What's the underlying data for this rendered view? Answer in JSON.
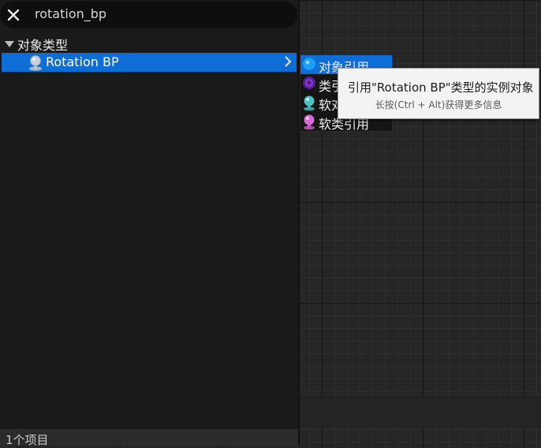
{
  "search": {
    "value": "rotation_bp",
    "clear_icon": "close-icon"
  },
  "tree": {
    "category_label": "对象类型",
    "selected_item": {
      "label": "Rotation BP",
      "icon": "blueprint-class-icon"
    }
  },
  "submenu": {
    "items": [
      {
        "label": "对象引用",
        "icon": "object-reference-icon",
        "color": "#1aa1f5"
      },
      {
        "label": "类引用",
        "icon": "class-reference-icon",
        "color": "#5a1b9e"
      },
      {
        "label": "软对象引用",
        "icon": "soft-object-reference-icon",
        "color": "#4fc0bf"
      },
      {
        "label": "软类引用",
        "icon": "soft-class-reference-icon",
        "color": "#d56ad5"
      }
    ]
  },
  "tooltip": {
    "title": "引用\"Rotation BP\"类型的实例对象",
    "hint": "长按(Ctrl + Alt)获得更多信息"
  },
  "footer": {
    "count_text": "1个项目"
  },
  "colors": {
    "selection": "#0f6ed6",
    "panel_bg": "#1a1a1a",
    "graph_bg": "#262626"
  }
}
